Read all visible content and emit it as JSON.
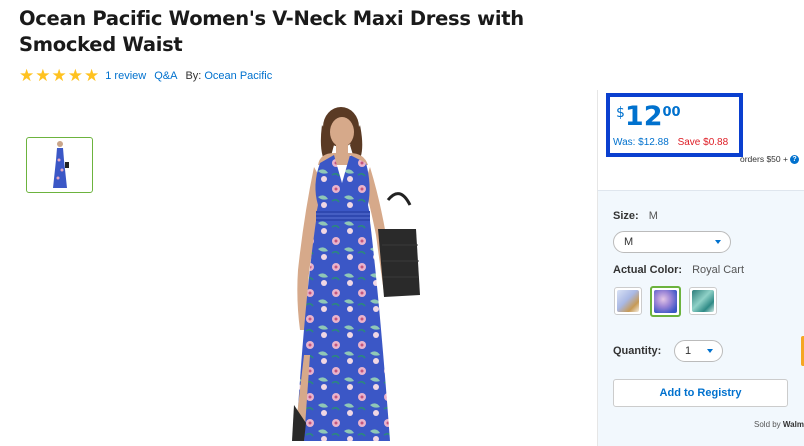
{
  "product": {
    "title": "Ocean Pacific Women's V-Neck Maxi Dress with Smocked Waist",
    "rating": 5,
    "review_link": "1 review",
    "qa_link": "Q&A",
    "by_label": "By:",
    "brand_link": "Ocean Pacific"
  },
  "price": {
    "currency_symbol": "$",
    "dollars": "12",
    "cents": "00",
    "was": "Was: $12.88",
    "save": "Save $0.88"
  },
  "shipping": {
    "text": "orders $50 +"
  },
  "options": {
    "size_label": "Size:",
    "size_value": "M",
    "size_select_value": "M",
    "color_label": "Actual Color:",
    "color_value": "Royal Cart",
    "quantity_label": "Quantity:",
    "quantity_value": "1"
  },
  "actions": {
    "registry_label": "Add to Registry",
    "sold_by_label": "Sold by",
    "sold_by_seller": "Walm"
  },
  "colors": {
    "link": "#0071ce",
    "star": "#ffc220",
    "save_red": "#de1c24",
    "selected_green": "#6cb33e",
    "highlight_box": "#0a3fcf",
    "dress_blue": "#3b57c6"
  },
  "icons": [
    "star-icon",
    "info-icon",
    "chevron-down-icon"
  ]
}
